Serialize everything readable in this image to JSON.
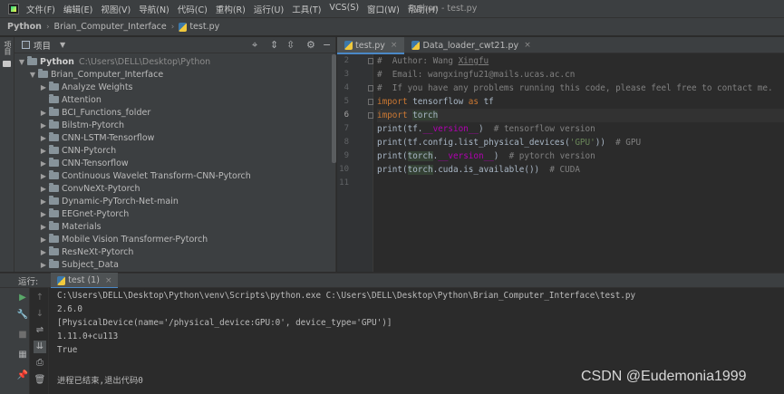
{
  "menubar": {
    "items": [
      "文件(F)",
      "编辑(E)",
      "视图(V)",
      "导航(N)",
      "代码(C)",
      "重构(R)",
      "运行(U)",
      "工具(T)",
      "VCS(S)",
      "窗口(W)",
      "帮助(H)"
    ],
    "window_title": "Python - test.py"
  },
  "breadcrumb": [
    "Python",
    "Brian_Computer_Interface",
    "test.py"
  ],
  "left_stripe": {
    "tab": "项目"
  },
  "project": {
    "title": "项目",
    "root": {
      "name": "Python",
      "path": "C:\\Users\\DELL\\Desktop\\Python"
    },
    "sub": "Brian_Computer_Interface",
    "folders": [
      {
        "name": "Analyze Weights",
        "expandable": true
      },
      {
        "name": "Attention",
        "expandable": false
      },
      {
        "name": "BCI_Functions_folder",
        "expandable": true
      },
      {
        "name": "Bilstm-Pytorch",
        "expandable": true
      },
      {
        "name": "CNN-LSTM-Tensorflow",
        "expandable": true
      },
      {
        "name": "CNN-Pytorch",
        "expandable": true
      },
      {
        "name": "CNN-Tensorflow",
        "expandable": true
      },
      {
        "name": "Continuous Wavelet Transform-CNN-Pytorch",
        "expandable": true
      },
      {
        "name": "ConvNeXt-Pytorch",
        "expandable": true
      },
      {
        "name": "Dynamic-PyTorch-Net-main",
        "expandable": true
      },
      {
        "name": "EEGnet-Pytorch",
        "expandable": true
      },
      {
        "name": "Materials",
        "expandable": true
      },
      {
        "name": "Mobile Vision Transformer-Pytorch",
        "expandable": true
      },
      {
        "name": "ResNeXt-Pytorch",
        "expandable": true
      },
      {
        "name": "Subject_Data",
        "expandable": true
      }
    ]
  },
  "editor": {
    "tabs": [
      {
        "label": "test.py",
        "active": true
      },
      {
        "label": "Data_loader_cwt21.py",
        "active": false
      }
    ],
    "current_line": 6,
    "lines": [
      {
        "no": 2,
        "parts": [
          {
            "t": "#  Author: Wang ",
            "c": "c-comment"
          },
          {
            "t": "Xingfu",
            "c": "c-comment c-uline"
          }
        ]
      },
      {
        "no": 3,
        "parts": [
          {
            "t": "#  Email: wangxingfu21@mails.ucas.ac.cn",
            "c": "c-comment"
          }
        ]
      },
      {
        "no": 4,
        "parts": [
          {
            "t": "#  If you have any problems running this code, please feel free to contact me.",
            "c": "c-comment"
          }
        ]
      },
      {
        "no": 5,
        "parts": [
          {
            "t": "import",
            "c": "c-kw"
          },
          {
            "t": " tensorflow ",
            "c": ""
          },
          {
            "t": "as",
            "c": "c-kw"
          },
          {
            "t": " tf",
            "c": ""
          }
        ]
      },
      {
        "no": 6,
        "parts": [
          {
            "t": "import",
            "c": "c-kw"
          },
          {
            "t": " ",
            "c": ""
          },
          {
            "t": "torch",
            "c": "c-hl"
          }
        ]
      },
      {
        "no": 7,
        "parts": [
          {
            "t": "print",
            "c": ""
          },
          {
            "t": "(tf.",
            "c": ""
          },
          {
            "t": "__version__",
            "c": "c-dunder"
          },
          {
            "t": ")  ",
            "c": ""
          },
          {
            "t": "# tensorflow version",
            "c": "c-comment"
          }
        ]
      },
      {
        "no": 8,
        "parts": [
          {
            "t": "print",
            "c": ""
          },
          {
            "t": "(tf.config.list_physical_devices(",
            "c": ""
          },
          {
            "t": "'GPU'",
            "c": "c-str"
          },
          {
            "t": "))  ",
            "c": ""
          },
          {
            "t": "# GPU",
            "c": "c-comment"
          }
        ]
      },
      {
        "no": 9,
        "parts": [
          {
            "t": "print",
            "c": ""
          },
          {
            "t": "(",
            "c": ""
          },
          {
            "t": "torch",
            "c": "c-hl"
          },
          {
            "t": ".",
            "c": ""
          },
          {
            "t": "__version__",
            "c": "c-dunder"
          },
          {
            "t": ")  ",
            "c": ""
          },
          {
            "t": "# pytorch version",
            "c": "c-comment"
          }
        ]
      },
      {
        "no": 10,
        "parts": [
          {
            "t": "print",
            "c": ""
          },
          {
            "t": "(",
            "c": ""
          },
          {
            "t": "torch",
            "c": "c-hl"
          },
          {
            "t": ".cuda.is_available())  ",
            "c": ""
          },
          {
            "t": "# CUDA",
            "c": "c-comment"
          }
        ]
      },
      {
        "no": 11,
        "parts": []
      }
    ]
  },
  "run": {
    "label": "运行:",
    "tab_label": "test (1)",
    "console": [
      "C:\\Users\\DELL\\Desktop\\Python\\venv\\Scripts\\python.exe C:\\Users\\DELL\\Desktop\\Python\\Brian_Computer_Interface\\test.py",
      "2.6.0",
      "[PhysicalDevice(name='/physical_device:GPU:0', device_type='GPU')]",
      "1.11.0+cu113",
      "True",
      "",
      "进程已结束,退出代码0"
    ]
  },
  "watermark": "CSDN @Eudemonia1999"
}
